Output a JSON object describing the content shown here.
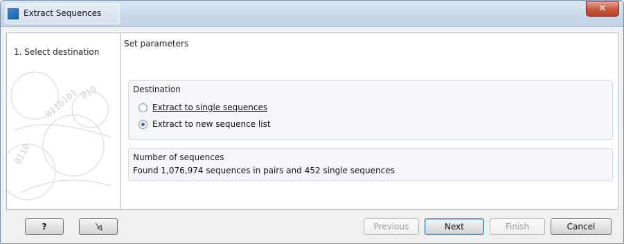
{
  "window": {
    "title": "Extract Sequences",
    "close_glyph": "✕"
  },
  "sidebar": {
    "steps": [
      {
        "number": "1.",
        "label": "Select destination"
      }
    ]
  },
  "main": {
    "heading": "Set parameters",
    "destination": {
      "title": "Destination",
      "options": [
        {
          "label": "Extract to single sequences",
          "selected": false
        },
        {
          "label": "Extract to new sequence list",
          "selected": true
        }
      ]
    },
    "number_of_sequences": {
      "title": "Number of sequences",
      "text": "Found 1,076,974 sequences in pairs and 452 single sequences"
    }
  },
  "footer": {
    "help_label": "?",
    "reset_icon": "reset-icon",
    "previous_label": "Previous",
    "next_label": "Next",
    "finish_label": "Finish",
    "cancel_label": "Cancel"
  },
  "colors": {
    "titlebar": "#c9d8ea",
    "close_button": "#c75c44",
    "radio_selected": "#2a6bc4"
  }
}
